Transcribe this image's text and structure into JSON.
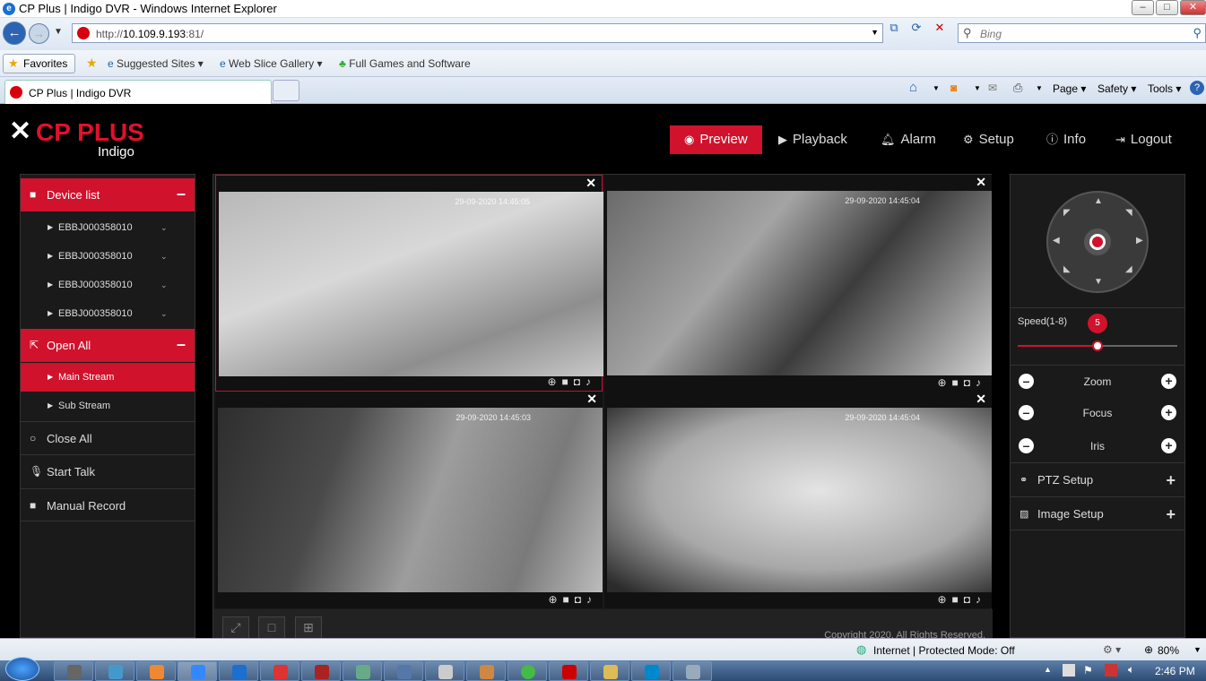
{
  "browser": {
    "window_title": "CP Plus | Indigo DVR - Windows Internet Explorer",
    "url_prefix": "http://",
    "url_host": "10.109.9.193",
    "url_suffix": ":81/",
    "search_placeholder": "Bing",
    "favorites_label": "Favorites",
    "fav_links": [
      "Suggested Sites",
      "Web Slice Gallery",
      "Full Games and Software"
    ],
    "tab_title": "CP Plus | Indigo DVR",
    "commands": [
      "Page",
      "Safety",
      "Tools"
    ],
    "status_text": "Internet | Protected Mode: Off",
    "zoom": "80%"
  },
  "app": {
    "logo_text": "CP PLUS",
    "logo_sub": "Indigo",
    "nav": [
      {
        "label": "Preview",
        "icon": "eye-icon",
        "active": true
      },
      {
        "label": "Playback",
        "icon": "play-icon"
      },
      {
        "label": "Alarm",
        "icon": "bell-icon"
      },
      {
        "label": "Setup",
        "icon": "gear-icon"
      },
      {
        "label": "Info",
        "icon": "info-icon"
      },
      {
        "label": "Logout",
        "icon": "logout-icon"
      }
    ]
  },
  "sidebar": {
    "device_list_label": "Device list",
    "devices": [
      "EBBJ000358010",
      "EBBJ000358010",
      "EBBJ000358010",
      "EBBJ000358010"
    ],
    "open_all_label": "Open All",
    "streams": [
      "Main Stream",
      "Sub Stream"
    ],
    "close_all_label": "Close All",
    "start_talk_label": "Start Talk",
    "manual_record_label": "Manual Record"
  },
  "cameras": [
    {
      "timestamp": "29-09-2020 14:45:05"
    },
    {
      "timestamp": "29-09-2020 14:45:04"
    },
    {
      "timestamp": "29-09-2020 14:45:03"
    },
    {
      "timestamp": "29-09-2020 14:45:04"
    }
  ],
  "copyright": "Copyright 2020, All Rights Reserved.",
  "ptz": {
    "speed_label": "Speed(1-8)",
    "speed_value": "5",
    "speed_level": 0.5,
    "zoom_label": "Zoom",
    "focus_label": "Focus",
    "iris_label": "Iris",
    "ptz_setup_label": "PTZ Setup",
    "image_setup_label": "Image Setup"
  },
  "taskbar": {
    "clock": "2:46 PM"
  }
}
